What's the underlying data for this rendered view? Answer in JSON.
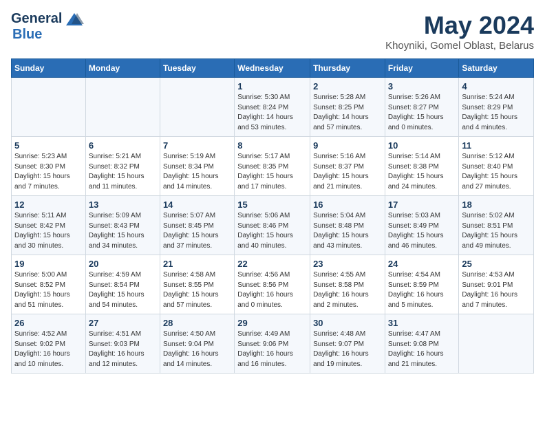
{
  "header": {
    "logo_general": "General",
    "logo_blue": "Blue",
    "month_year": "May 2024",
    "location": "Khoyniki, Gomel Oblast, Belarus"
  },
  "weekdays": [
    "Sunday",
    "Monday",
    "Tuesday",
    "Wednesday",
    "Thursday",
    "Friday",
    "Saturday"
  ],
  "weeks": [
    [
      {
        "day": "",
        "info": ""
      },
      {
        "day": "",
        "info": ""
      },
      {
        "day": "",
        "info": ""
      },
      {
        "day": "1",
        "info": "Sunrise: 5:30 AM\nSunset: 8:24 PM\nDaylight: 14 hours\nand 53 minutes."
      },
      {
        "day": "2",
        "info": "Sunrise: 5:28 AM\nSunset: 8:25 PM\nDaylight: 14 hours\nand 57 minutes."
      },
      {
        "day": "3",
        "info": "Sunrise: 5:26 AM\nSunset: 8:27 PM\nDaylight: 15 hours\nand 0 minutes."
      },
      {
        "day": "4",
        "info": "Sunrise: 5:24 AM\nSunset: 8:29 PM\nDaylight: 15 hours\nand 4 minutes."
      }
    ],
    [
      {
        "day": "5",
        "info": "Sunrise: 5:23 AM\nSunset: 8:30 PM\nDaylight: 15 hours\nand 7 minutes."
      },
      {
        "day": "6",
        "info": "Sunrise: 5:21 AM\nSunset: 8:32 PM\nDaylight: 15 hours\nand 11 minutes."
      },
      {
        "day": "7",
        "info": "Sunrise: 5:19 AM\nSunset: 8:34 PM\nDaylight: 15 hours\nand 14 minutes."
      },
      {
        "day": "8",
        "info": "Sunrise: 5:17 AM\nSunset: 8:35 PM\nDaylight: 15 hours\nand 17 minutes."
      },
      {
        "day": "9",
        "info": "Sunrise: 5:16 AM\nSunset: 8:37 PM\nDaylight: 15 hours\nand 21 minutes."
      },
      {
        "day": "10",
        "info": "Sunrise: 5:14 AM\nSunset: 8:38 PM\nDaylight: 15 hours\nand 24 minutes."
      },
      {
        "day": "11",
        "info": "Sunrise: 5:12 AM\nSunset: 8:40 PM\nDaylight: 15 hours\nand 27 minutes."
      }
    ],
    [
      {
        "day": "12",
        "info": "Sunrise: 5:11 AM\nSunset: 8:42 PM\nDaylight: 15 hours\nand 30 minutes."
      },
      {
        "day": "13",
        "info": "Sunrise: 5:09 AM\nSunset: 8:43 PM\nDaylight: 15 hours\nand 34 minutes."
      },
      {
        "day": "14",
        "info": "Sunrise: 5:07 AM\nSunset: 8:45 PM\nDaylight: 15 hours\nand 37 minutes."
      },
      {
        "day": "15",
        "info": "Sunrise: 5:06 AM\nSunset: 8:46 PM\nDaylight: 15 hours\nand 40 minutes."
      },
      {
        "day": "16",
        "info": "Sunrise: 5:04 AM\nSunset: 8:48 PM\nDaylight: 15 hours\nand 43 minutes."
      },
      {
        "day": "17",
        "info": "Sunrise: 5:03 AM\nSunset: 8:49 PM\nDaylight: 15 hours\nand 46 minutes."
      },
      {
        "day": "18",
        "info": "Sunrise: 5:02 AM\nSunset: 8:51 PM\nDaylight: 15 hours\nand 49 minutes."
      }
    ],
    [
      {
        "day": "19",
        "info": "Sunrise: 5:00 AM\nSunset: 8:52 PM\nDaylight: 15 hours\nand 51 minutes."
      },
      {
        "day": "20",
        "info": "Sunrise: 4:59 AM\nSunset: 8:54 PM\nDaylight: 15 hours\nand 54 minutes."
      },
      {
        "day": "21",
        "info": "Sunrise: 4:58 AM\nSunset: 8:55 PM\nDaylight: 15 hours\nand 57 minutes."
      },
      {
        "day": "22",
        "info": "Sunrise: 4:56 AM\nSunset: 8:56 PM\nDaylight: 16 hours\nand 0 minutes."
      },
      {
        "day": "23",
        "info": "Sunrise: 4:55 AM\nSunset: 8:58 PM\nDaylight: 16 hours\nand 2 minutes."
      },
      {
        "day": "24",
        "info": "Sunrise: 4:54 AM\nSunset: 8:59 PM\nDaylight: 16 hours\nand 5 minutes."
      },
      {
        "day": "25",
        "info": "Sunrise: 4:53 AM\nSunset: 9:01 PM\nDaylight: 16 hours\nand 7 minutes."
      }
    ],
    [
      {
        "day": "26",
        "info": "Sunrise: 4:52 AM\nSunset: 9:02 PM\nDaylight: 16 hours\nand 10 minutes."
      },
      {
        "day": "27",
        "info": "Sunrise: 4:51 AM\nSunset: 9:03 PM\nDaylight: 16 hours\nand 12 minutes."
      },
      {
        "day": "28",
        "info": "Sunrise: 4:50 AM\nSunset: 9:04 PM\nDaylight: 16 hours\nand 14 minutes."
      },
      {
        "day": "29",
        "info": "Sunrise: 4:49 AM\nSunset: 9:06 PM\nDaylight: 16 hours\nand 16 minutes."
      },
      {
        "day": "30",
        "info": "Sunrise: 4:48 AM\nSunset: 9:07 PM\nDaylight: 16 hours\nand 19 minutes."
      },
      {
        "day": "31",
        "info": "Sunrise: 4:47 AM\nSunset: 9:08 PM\nDaylight: 16 hours\nand 21 minutes."
      },
      {
        "day": "",
        "info": ""
      }
    ]
  ]
}
